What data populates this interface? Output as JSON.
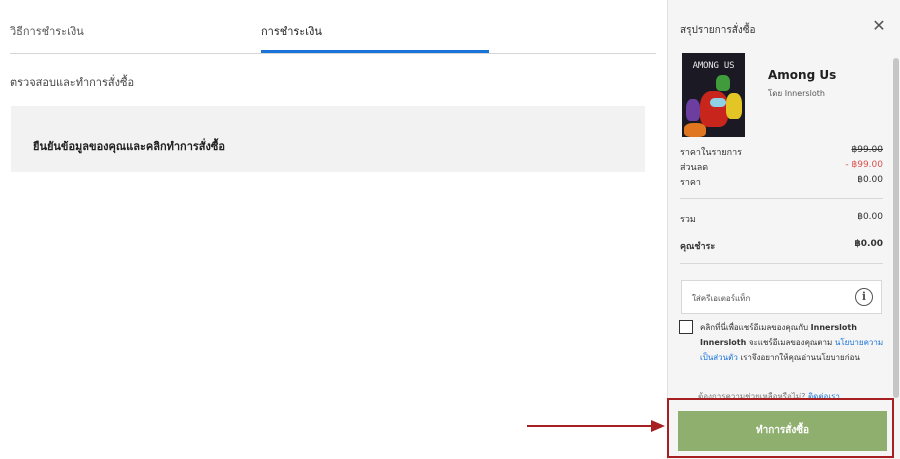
{
  "tabs": {
    "method": "วิธีการชำระเงิน",
    "payment": "การชำระเงิน"
  },
  "checkout": {
    "section_title": "ตรวจสอบและทำการสั่งซื้อ",
    "confirm_text": "ยืนยันข้อมูลของคุณและคลิกทำการสั่งซื้อ"
  },
  "summary": {
    "title": "สรุปรายการสั่งซื้อ",
    "close_icon": "close-icon",
    "cover_logo": "AMONG US",
    "game_title": "Among Us",
    "publisher": "โดย Innersloth",
    "rows": [
      {
        "label": "ราคาในรายการ",
        "value": "฿99.00"
      },
      {
        "label": "ส่วนลด",
        "value": "- ฿99.00"
      },
      {
        "label": "ราคา",
        "value": "฿0.00"
      }
    ],
    "total": {
      "label": "รวม",
      "value": "฿0.00"
    },
    "pay": {
      "label": "คุณชำระ",
      "value": "฿0.00"
    },
    "creator_placeholder": "ใส่ครีเอเตอร์แท็ก",
    "info_icon": "info-icon",
    "consent": {
      "p1": "คลิกที่นี่เพื่อแชร์อีเมลของคุณกับ",
      "publisher_bold": "Innersloth Innersloth",
      "p2": "จะแชร์อีเมลของคุณตาม",
      "policy_link": "นโยบายความเป็นส่วนตัว",
      "p3": "เราจึงอยากให้คุณอ่านนโยบายก่อน"
    },
    "help_text": "ต้องการความช่วยเหลือหรือไม่?",
    "help_link": "ติดต่อเรา",
    "order_button": "ทำการสั่งซื้อ"
  },
  "colors": {
    "accent": "#1a73d9",
    "order_button": "#8faf6e",
    "highlight": "#a81f22",
    "discount": "#d9534f"
  }
}
